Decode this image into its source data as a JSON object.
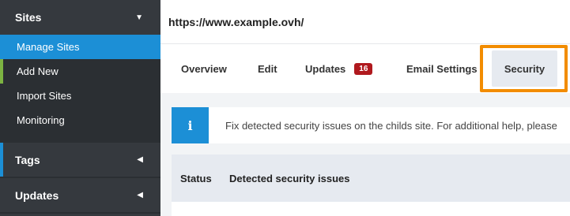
{
  "sidebar": {
    "sites": {
      "label": "Sites"
    },
    "items": [
      {
        "label": "Manage Sites"
      },
      {
        "label": "Add New"
      },
      {
        "label": "Import Sites"
      },
      {
        "label": "Monitoring"
      }
    ],
    "tags": {
      "label": "Tags"
    },
    "updates": {
      "label": "Updates"
    }
  },
  "header": {
    "url": "https://www.example.ovh/"
  },
  "tabs": {
    "overview": "Overview",
    "edit": "Edit",
    "updates": "Updates",
    "updates_badge": "16",
    "email_settings": "Email Settings",
    "security": "Security"
  },
  "notice": {
    "icon": "i",
    "text": "Fix detected security issues on the childs site. For additional help, please"
  },
  "table": {
    "columns": [
      "Status",
      "Detected security issues"
    ]
  },
  "colors": {
    "sidebar_bg": "#2b2f33",
    "accent_blue": "#1c8fd6",
    "highlight_orange": "#f28c00",
    "badge_red": "#b0191e"
  }
}
